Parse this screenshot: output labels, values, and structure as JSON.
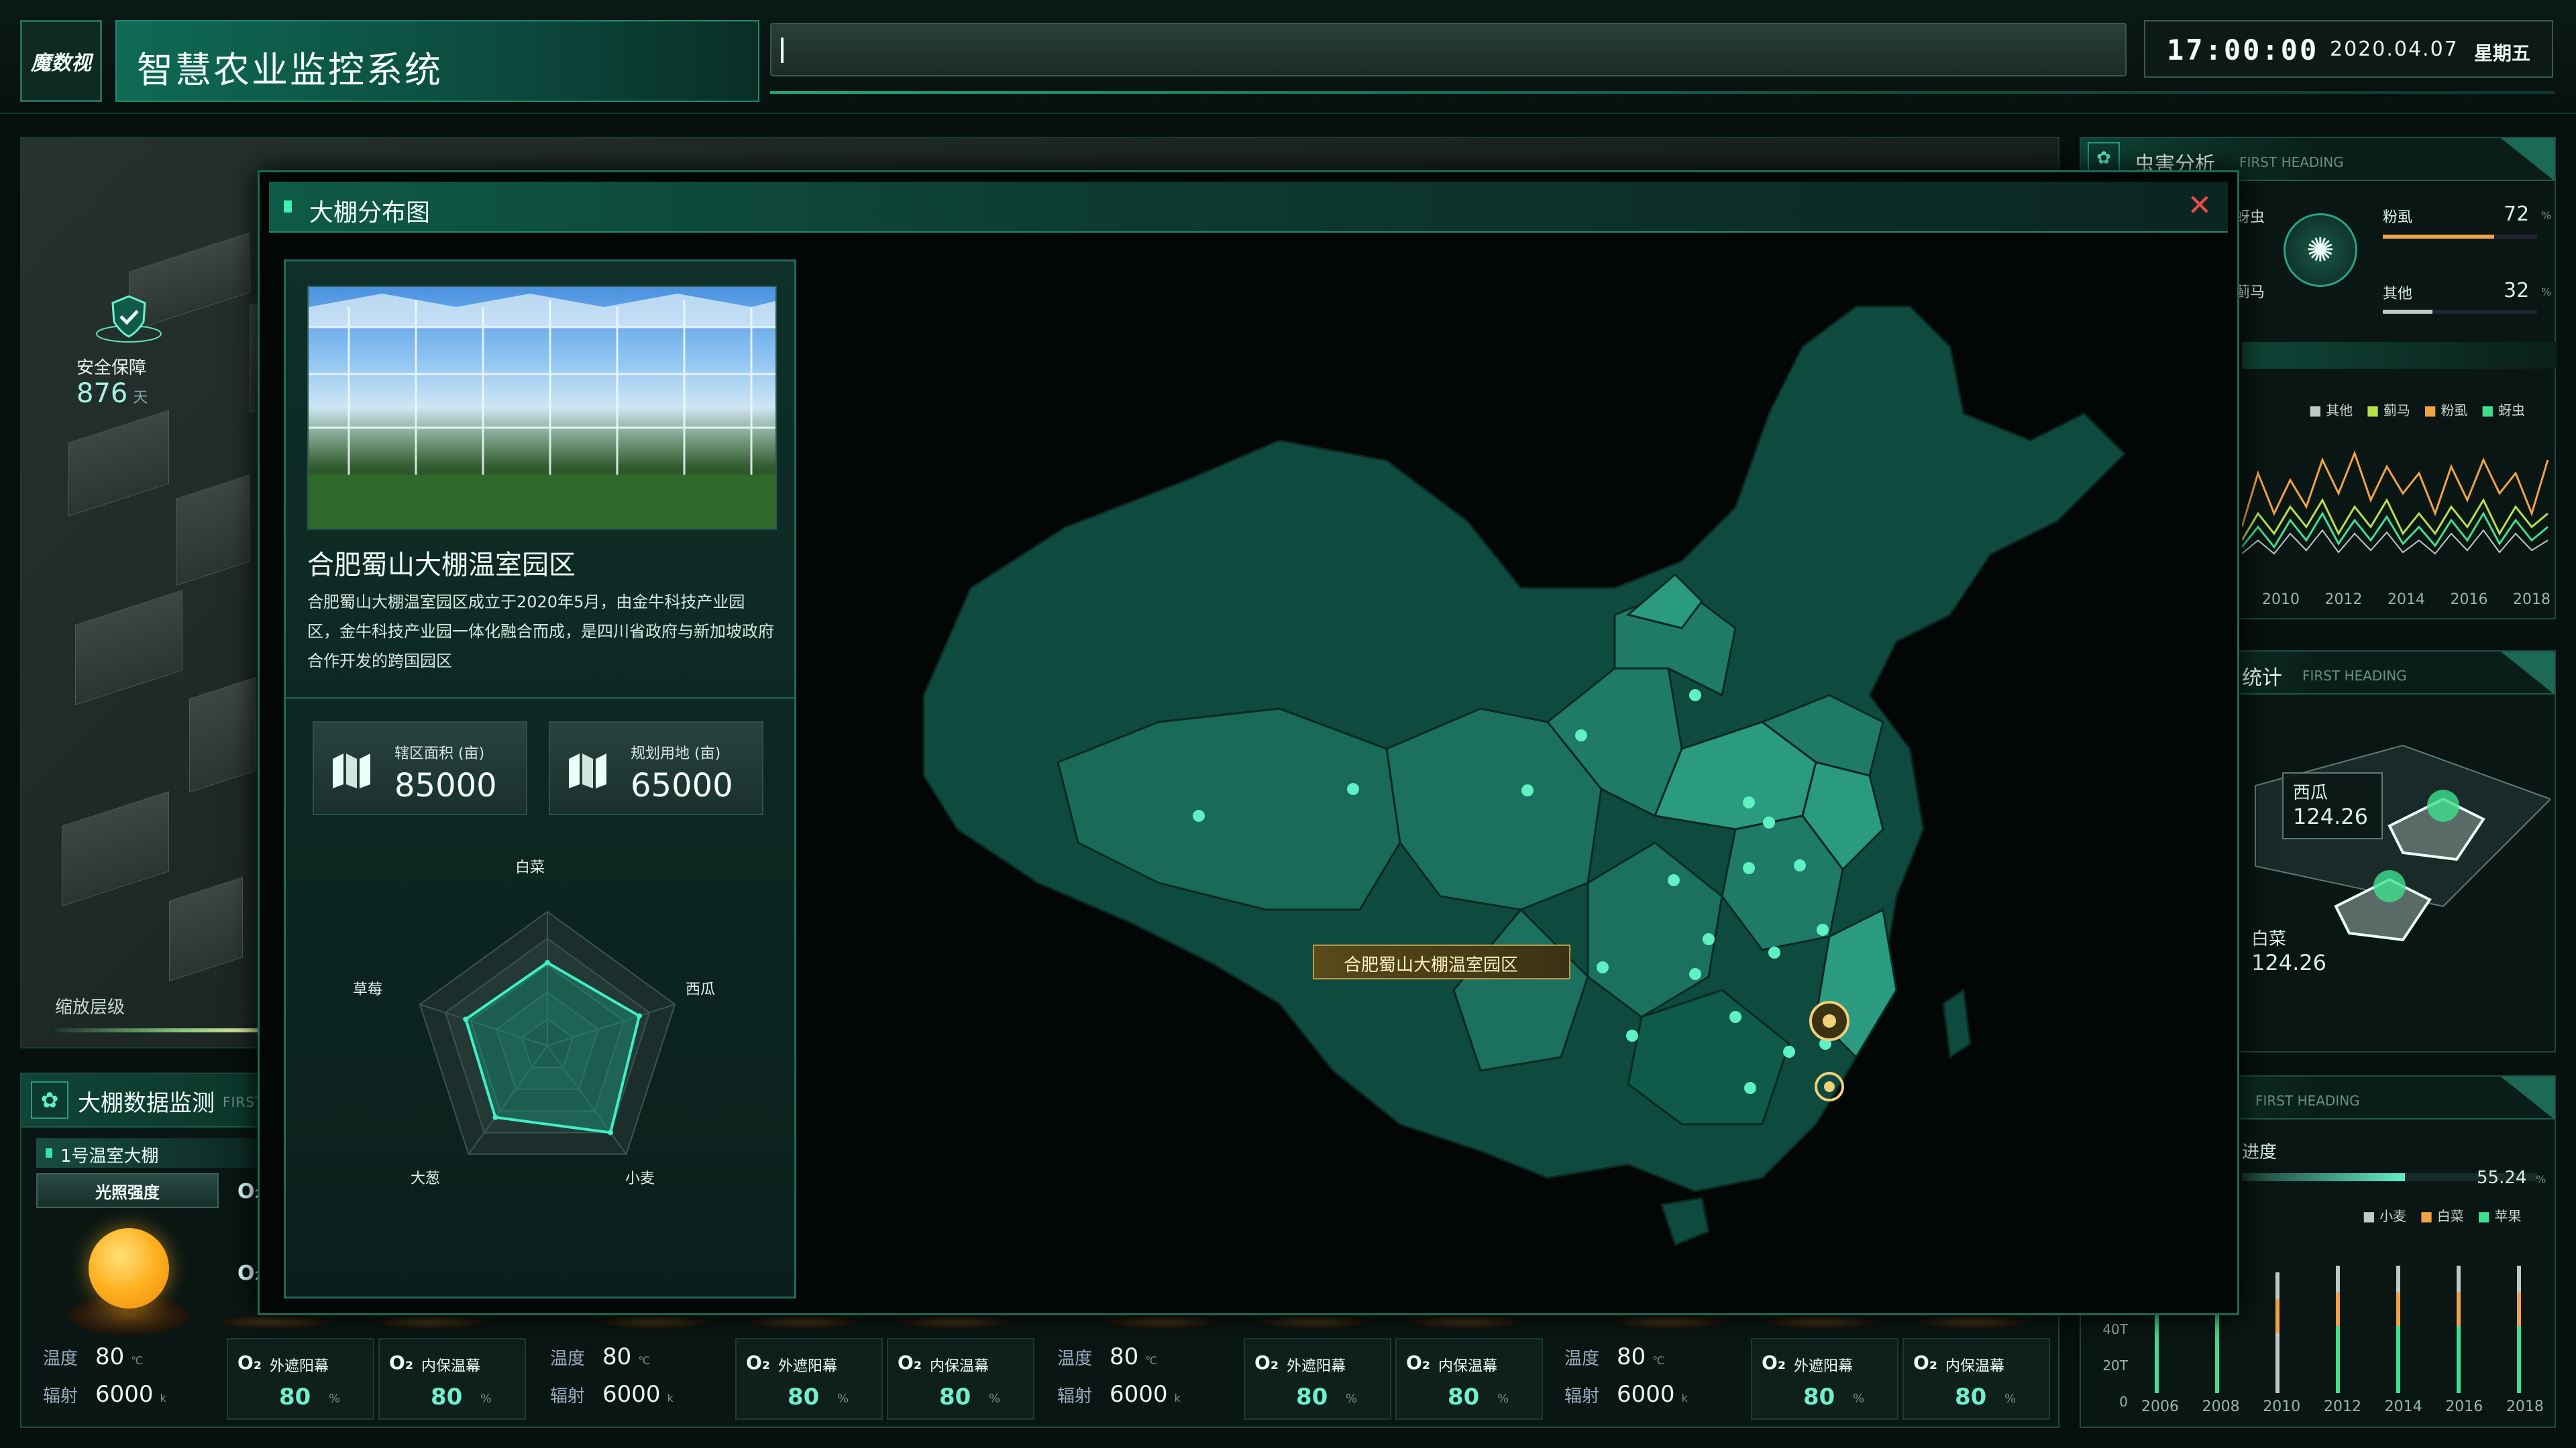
{
  "header": {
    "logo_text": "魔数视",
    "title": "智慧农业监控系统",
    "time": "17:00:00",
    "date": "2020.04.07",
    "weekday": "星期五"
  },
  "scene": {
    "safety_label": "安全保障",
    "safety_value": "876",
    "safety_unit": "天",
    "zoom_label": "缩放层级"
  },
  "monitor": {
    "title": "大棚数据监测",
    "subtitle": "FIRST HEADING",
    "greenhouse_label": "1号温室大棚",
    "light_tab": "光照强度",
    "temp_label": "温度",
    "temp_value": "80",
    "temp_unit": "℃",
    "rad_label": "辐射",
    "rad_value": "6000",
    "rad_unit": "k",
    "o2_symbol": "O₂",
    "outer_label": "外遮阳幕",
    "inner_label": "内保温幕",
    "screen_value": "80",
    "screen_unit": "%"
  },
  "pest": {
    "title": "虫害分析",
    "subtitle": "FIRST HEADING",
    "items": [
      {
        "name": "蚜虫",
        "value": "",
        "color": "#3ee08f"
      },
      {
        "name": "粉虱",
        "value": "72",
        "unit": "%",
        "color": "#f0a246"
      },
      {
        "name": "蓟马",
        "value": "",
        "color": "#b6e04a"
      },
      {
        "name": "其他",
        "value": "32",
        "unit": "%",
        "color": "#bfc8c6"
      }
    ],
    "legend": [
      "其他",
      "蓟马",
      "粉虱",
      "蚜虫"
    ],
    "x_ticks": [
      "2010",
      "2012",
      "2014",
      "2016",
      "2018"
    ]
  },
  "stats": {
    "title": "统计",
    "subtitle": "FIRST HEADING",
    "items": [
      {
        "name": "西瓜",
        "value": "124.26"
      },
      {
        "name": "白菜",
        "value": "124.26"
      }
    ]
  },
  "progress": {
    "subtitle": "FIRST HEADING",
    "label": "进度",
    "value": "55.24",
    "unit": "%",
    "fraction": 0.5524,
    "legend": [
      "小麦",
      "白菜",
      "苹果"
    ],
    "y_ticks": [
      "40T",
      "20T",
      "0"
    ],
    "x_ticks": [
      "2006",
      "2008",
      "2010",
      "2012",
      "2014",
      "2016",
      "2018"
    ]
  },
  "modal": {
    "title": "大棚分布图",
    "close_icon": "close-icon",
    "park_name": "合肥蜀山大棚温室园区",
    "park_desc": "合肥蜀山大棚温室园区成立于2020年5月，由金牛科技产业园区，金牛科技产业园一体化融合而成，是四川省政府与新加坡政府合作开发的跨国园区",
    "area_label": "辖区面积 (亩)",
    "area_value": "85000",
    "land_label": "规划用地 (亩)",
    "land_value": "65000",
    "map_marker_label": "合肥蜀山大棚温室园区"
  },
  "chart_data": {
    "type": "radar",
    "categories": [
      "白菜",
      "西瓜",
      "小麦",
      "大葱",
      "草莓"
    ],
    "values": [
      0.62,
      0.72,
      0.8,
      0.66,
      0.64
    ],
    "ylim": [
      0,
      1
    ]
  }
}
